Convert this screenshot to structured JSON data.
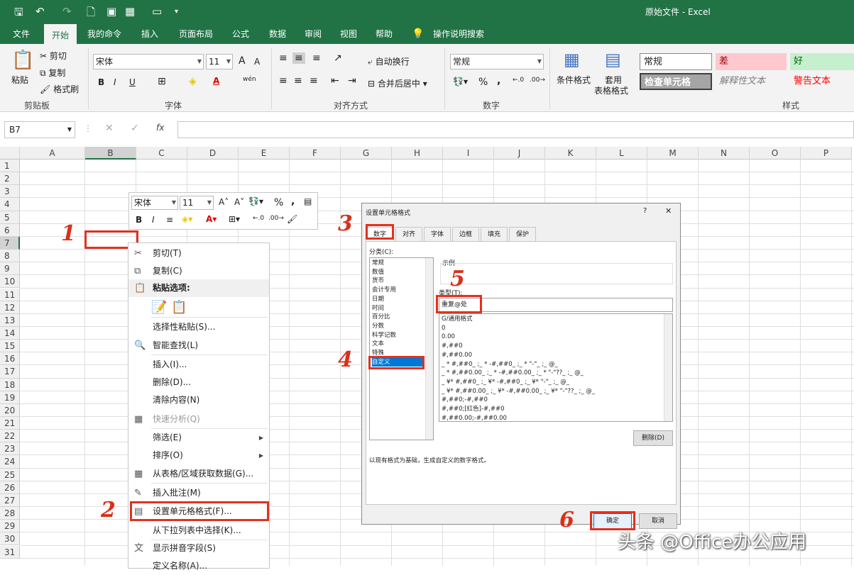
{
  "title": {
    "doc": "原始文件  -  Excel"
  },
  "menu": [
    "文件",
    "开始",
    "我的命令",
    "插入",
    "页面布局",
    "公式",
    "数据",
    "审阅",
    "视图",
    "帮助",
    "操作说明搜索"
  ],
  "ribbon": {
    "clipboard": {
      "paste": "粘贴",
      "cut": "剪切",
      "copy": "复制",
      "format_painter": "格式刷",
      "label": "剪贴板"
    },
    "font": {
      "name": "宋体",
      "size": "11",
      "label": "字体",
      "bold": "B",
      "italic": "I",
      "underline": "U",
      "grow": "A",
      "shrink": "A",
      "phonetic": "wén"
    },
    "align": {
      "wrap": "自动换行",
      "merge": "合并后居中",
      "label": "对齐方式"
    },
    "number": {
      "format": "常规",
      "percent": "%",
      "comma": ",",
      "label": "数字"
    },
    "styles": {
      "cond": "条件格式",
      "table": "套用",
      "table2": "表格格式",
      "normal": "常规",
      "bad": "差",
      "good": "好",
      "check": "检查单元格",
      "explain": "解释性文本",
      "warn": "警告文本",
      "label": "样式"
    }
  },
  "formula_bar": {
    "name_box": "B7",
    "fx": "fx"
  },
  "columns": [
    "A",
    "B",
    "C",
    "D",
    "E",
    "F",
    "G",
    "H",
    "I",
    "J",
    "K",
    "L",
    "M",
    "N",
    "O",
    "P"
  ],
  "rows": [
    "1",
    "2",
    "3",
    "4",
    "5",
    "6",
    "7",
    "8",
    "9",
    "10",
    "11",
    "12",
    "13",
    "14",
    "15",
    "16",
    "17",
    "18",
    "19",
    "20",
    "21",
    "22",
    "23",
    "24",
    "25",
    "26",
    "27",
    "28",
    "29",
    "30",
    "31"
  ],
  "minibar": {
    "font": "宋体",
    "size": "11",
    "percent": "%",
    "comma": ","
  },
  "context_menu": [
    {
      "label": "剪切(T)",
      "icon": "✂"
    },
    {
      "label": "复制(C)",
      "icon": "⧉"
    },
    {
      "label": "粘贴选项:",
      "icon": "📋",
      "header": true
    },
    {
      "label": "",
      "icon": ""
    },
    {
      "label": "选择性粘贴(S)...",
      "icon": ""
    },
    {
      "label": "智能查找(L)",
      "icon": "🔍"
    },
    {
      "label": "插入(I)...",
      "icon": ""
    },
    {
      "label": "删除(D)...",
      "icon": ""
    },
    {
      "label": "清除内容(N)",
      "icon": ""
    },
    {
      "label": "快速分析(Q)",
      "icon": "▦",
      "disabled": true
    },
    {
      "label": "筛选(E)",
      "icon": "",
      "sub": true
    },
    {
      "label": "排序(O)",
      "icon": "",
      "sub": true
    },
    {
      "label": "从表格/区域获取数据(G)...",
      "icon": "▦"
    },
    {
      "label": "插入批注(M)",
      "icon": "✎"
    },
    {
      "label": "设置单元格格式(F)...",
      "icon": "▤"
    },
    {
      "label": "从下拉列表中选择(K)...",
      "icon": ""
    },
    {
      "label": "显示拼音字段(S)",
      "icon": "文"
    },
    {
      "label": "定义名称(A)...",
      "icon": ""
    }
  ],
  "dialog": {
    "title": "设置单元格格式",
    "help": "?",
    "close": "✕",
    "tabs": [
      "数字",
      "对齐",
      "字体",
      "边框",
      "填充",
      "保护"
    ],
    "category_label": "分类(C):",
    "categories": [
      "常规",
      "数值",
      "货币",
      "会计专用",
      "日期",
      "时间",
      "百分比",
      "分数",
      "科学记数",
      "文本",
      "特殊",
      "自定义"
    ],
    "sample_label": "示例",
    "type_label": "类型(T):",
    "type_value": "重复@处",
    "formats": [
      "G/通用格式",
      "0",
      "0.00",
      "#,##0",
      "#,##0.00",
      "_ * #,##0_ ;_ * -#,##0_ ;_ * \"-\"_ ;_ @_",
      "_ * #,##0.00_ ;_ * -#,##0.00_ ;_ * \"-\"??_ ;_ @_",
      "_ ¥* #,##0_ ;_ ¥* -#,##0_ ;_ ¥* \"-\"_ ;_ @_",
      "_ ¥* #,##0.00_ ;_ ¥* -#,##0.00_ ;_ ¥* \"-\"??_ ;_ @_",
      "#,##0;-#,##0",
      "#,##0;[红色]-#,##0",
      "#,##0.00;-#,##0.00"
    ],
    "delete": "删除(D)",
    "desc": "以现有格式为基础，生成自定义的数字格式。",
    "ok": "确定",
    "cancel": "取消"
  },
  "annotations": [
    "1",
    "2",
    "3",
    "4",
    "5",
    "6"
  ],
  "watermark": "头条 @Office办公应用",
  "colors": {
    "excel_green": "#217346",
    "annotation_red": "#e0321f",
    "selection_blue": "#0078d7"
  }
}
